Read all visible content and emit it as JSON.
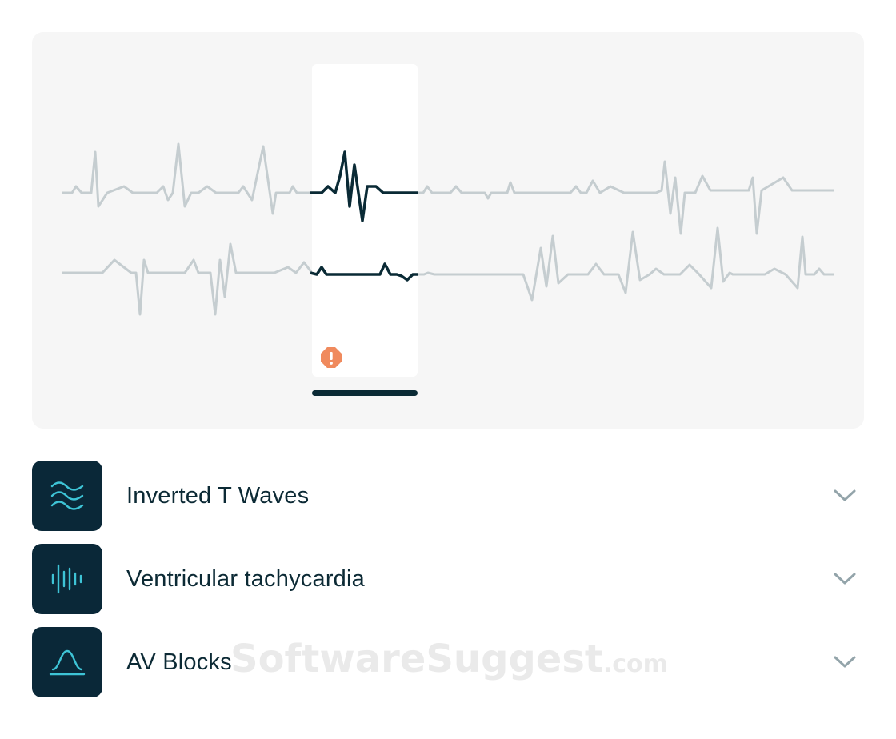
{
  "items": [
    {
      "label": "Inverted T Waves",
      "icon": "waves-icon"
    },
    {
      "label": "Ventricular tachycardia",
      "icon": "frequency-bars-icon"
    },
    {
      "label": "AV Blocks",
      "icon": "bell-curve-icon"
    }
  ],
  "watermark": {
    "text": "SoftwareSuggest",
    "suffix": ".com"
  },
  "colors": {
    "tile_background": "#0a2838",
    "icon_accent": "#3ec4d6",
    "trace_gray": "#c5cdd0",
    "trace_dark": "#0a2a35",
    "alert": "#f08a5d",
    "panel": "#f6f6f6"
  }
}
